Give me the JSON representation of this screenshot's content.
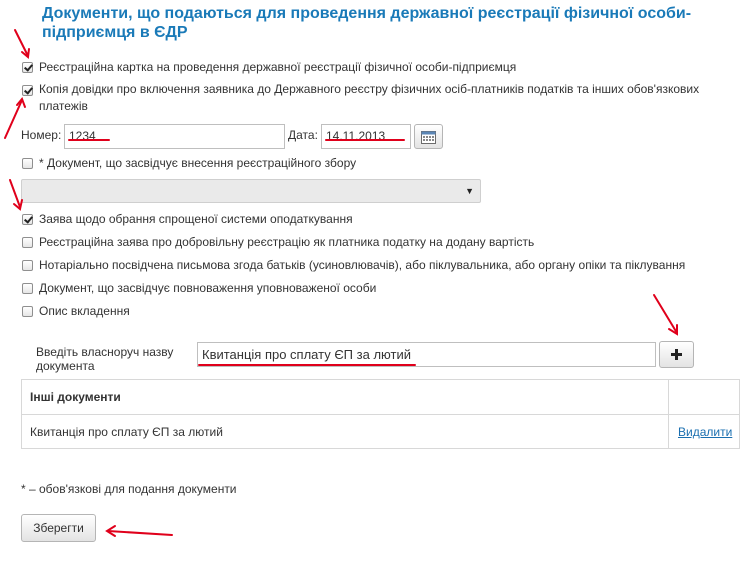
{
  "title": "Документи, що подаються для проведення державної реєстрації фізичної особи-підприємця в ЄДР",
  "checkboxes": [
    {
      "label": "Реєстраційна картка на проведення державної реєстрації фізичної особи-підприємця",
      "checked": true
    },
    {
      "label": "Копія довідки про включення заявника до Державного реєстру фізичних осіб-платників податків та інших обов'язкових платежів",
      "checked": true
    },
    {
      "label": "* Документ, що засвідчує внесення реєстраційного збору",
      "checked": false
    },
    {
      "label": "Заява щодо обрання спрощеної системи оподаткування",
      "checked": true
    },
    {
      "label": "Реєстраційна заява про добровільну реєстрацію як платника податку на додану вартість",
      "checked": false
    },
    {
      "label": "Нотаріально посвідчена письмова згода батьків (усиновлювачів), або піклувальника, або органу опіки та піклування",
      "checked": false
    },
    {
      "label": "Документ, що засвідчує повноваження уповноваженої особи",
      "checked": false
    },
    {
      "label": "Опис вкладення",
      "checked": false
    }
  ],
  "number": {
    "label": "Номер:",
    "value": "1234"
  },
  "date": {
    "label": "Дата:",
    "value": "14.11.2013"
  },
  "icons": {
    "calendar": "calendar-icon",
    "dropdown": "chevron-down-icon",
    "add": "plus-icon"
  },
  "custom_doc": {
    "label": "Введіть власноруч назву документа",
    "value": "Квитанція про сплату ЄП за лютий"
  },
  "add_button": "+",
  "table": {
    "header": "Інші документи",
    "rows": [
      {
        "name": "Квитанція про сплату ЄП за лютий",
        "action": "Видалити"
      }
    ]
  },
  "footnote": "* – обов'язкові для подання документи",
  "save_button": "Зберегти",
  "colors": {
    "title": "#1a7ab8",
    "link": "#1a6fb0",
    "annotation": "#e0001b"
  }
}
